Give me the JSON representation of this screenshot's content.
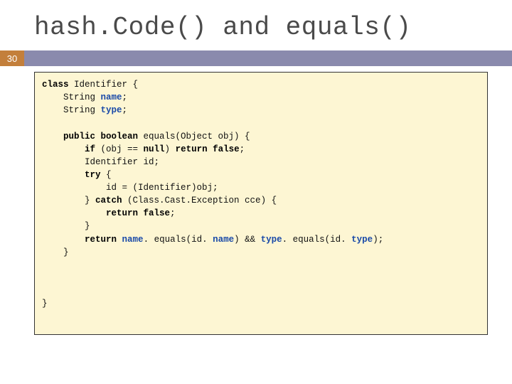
{
  "title": {
    "part1": "hash.Code()",
    "and": " and ",
    "part2": "equals()"
  },
  "slide_number": "30",
  "code": {
    "l1a": "class",
    "l1b": " Identifier {",
    "l2a": "    String ",
    "l2b": "name",
    "l2c": ";",
    "l3a": "    String ",
    "l3b": "type",
    "l3c": ";",
    "blank1": "",
    "l4a": "    public boolean",
    "l4b": " equals(Object obj) {",
    "l5a": "        if",
    "l5b": " (obj == ",
    "l5c": "null",
    "l5d": ") ",
    "l5e": "return false",
    "l5f": ";",
    "l6": "        Identifier id;",
    "l7a": "        try",
    "l7b": " {",
    "l8": "            id = (Identifier)obj;",
    "l9a": "        } ",
    "l9b": "catch",
    "l9c": " (Class.Cast.Exception cce) {",
    "l10a": "            return false",
    "l10b": ";",
    "l11": "        }",
    "l12a": "        return",
    "l12b": " ",
    "l12c": "name",
    "l12d": ". equals(id. ",
    "l12e": "name",
    "l12f": ") && ",
    "l12g": "type",
    "l12h": ". equals(id. ",
    "l12i": "type",
    "l12j": ");",
    "l13": "    }",
    "blank2": "",
    "blank3": "",
    "blank4": "",
    "l14": "}"
  }
}
